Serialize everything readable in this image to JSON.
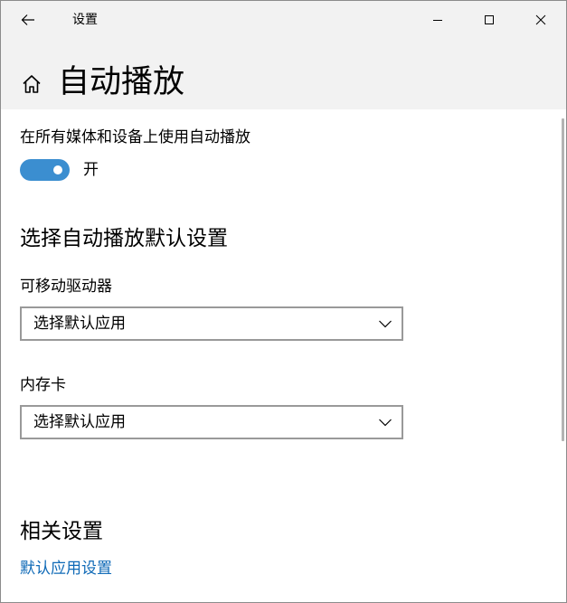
{
  "titlebar": {
    "title": "设置",
    "back_icon": "back-arrow-icon",
    "minimize_icon": "minimize-icon",
    "maximize_icon": "maximize-icon",
    "close_icon": "close-icon"
  },
  "header": {
    "home_icon": "home-icon",
    "page_title": "自动播放"
  },
  "autoplay": {
    "label": "在所有媒体和设备上使用自动播放",
    "toggle_on": true,
    "toggle_state": "开"
  },
  "defaults": {
    "section_title": "选择自动播放默认设置",
    "removable_drive": {
      "label": "可移动驱动器",
      "selected": "选择默认应用"
    },
    "memory_card": {
      "label": "内存卡",
      "selected": "选择默认应用"
    }
  },
  "related": {
    "section_title": "相关设置",
    "link": "默认应用设置"
  },
  "colors": {
    "accent": "#3b8ed0",
    "link": "#0f6ab7",
    "header_bg": "#f2f2f2",
    "dropdown_border": "#999999"
  }
}
